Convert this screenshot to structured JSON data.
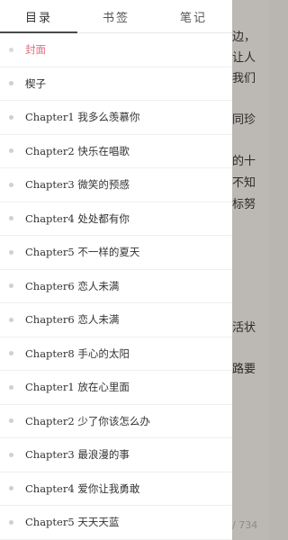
{
  "tabs": [
    {
      "label": "目录"
    },
    {
      "label": "书签"
    },
    {
      "label": "笔记"
    }
  ],
  "chapters": [
    {
      "title": "封面"
    },
    {
      "title": "楔子"
    },
    {
      "title": "Chapter1 我多么羡慕你"
    },
    {
      "title": "Chapter2 快乐在唱歌"
    },
    {
      "title": "Chapter3 微笑的预感"
    },
    {
      "title": "Chapter4 处处都有你"
    },
    {
      "title": "Chapter5 不一样的夏天"
    },
    {
      "title": "Chapter6 恋人未满"
    },
    {
      "title": "Chapter6 恋人未满"
    },
    {
      "title": "Chapter8 手心的太阳"
    },
    {
      "title": "Chapter1 放在心里面"
    },
    {
      "title": "Chapter2 少了你该怎么办"
    },
    {
      "title": "Chapter3 最浪漫的事"
    },
    {
      "title": "Chapter4 爱你让我勇敢"
    },
    {
      "title": "Chapter5 天天天蓝"
    }
  ],
  "reader": {
    "lines": [
      "边，",
      "让人",
      "我们",
      "同珍",
      "的十",
      "不知",
      "标努",
      "活状",
      "路要"
    ],
    "page_indicator": "/ 734"
  }
}
